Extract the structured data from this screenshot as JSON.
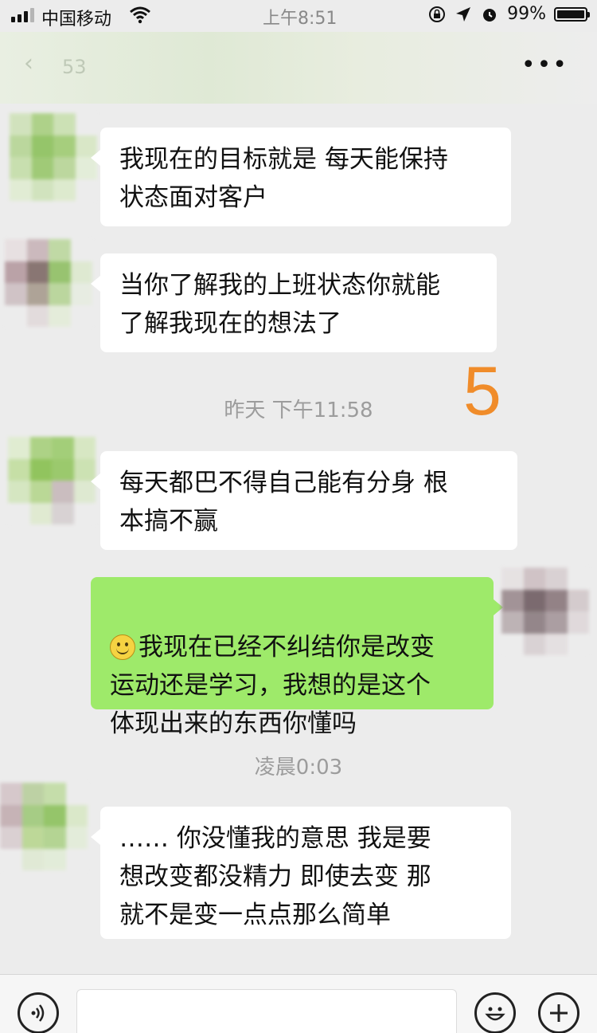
{
  "status_bar": {
    "carrier": "中国移动",
    "time": "上午8:51",
    "battery": "99%"
  },
  "nav": {
    "back_icon": "chevron-left-icon",
    "count": "53",
    "more": "•••"
  },
  "messages": [
    {
      "side": "left",
      "text": "我现在的目标就是  每天能保持\n状态面对客户"
    },
    {
      "side": "left",
      "text": "当你了解我的上班状态你就能\n了解我现在的想法了"
    },
    {
      "side": "left",
      "text": "每天都巴不得自己能有分身   根\n本搞不赢"
    },
    {
      "side": "right",
      "text": "我现在已经不纠结你是改变\n运动还是学习，我想的是这个\n体现出来的东西你懂吗"
    },
    {
      "side": "left",
      "text": "……   你没懂我的意思   我是要\n想改变都没精力   即使去变   那\n就不是变一点点那么简单"
    }
  ],
  "timestamps": {
    "t1": "昨天  下午11:58",
    "t2": "凌晨0:03"
  },
  "overlay_number": "5",
  "bottom_bar": {
    "voice_icon": "voice-icon",
    "emoji_icon": "emoji-icon",
    "plus_icon": "plus-icon"
  },
  "colors": {
    "bubble_right": "#9eea6a",
    "bubble_left": "#ffffff",
    "background": "#ececec",
    "overlay_number": "#f08c2a"
  }
}
